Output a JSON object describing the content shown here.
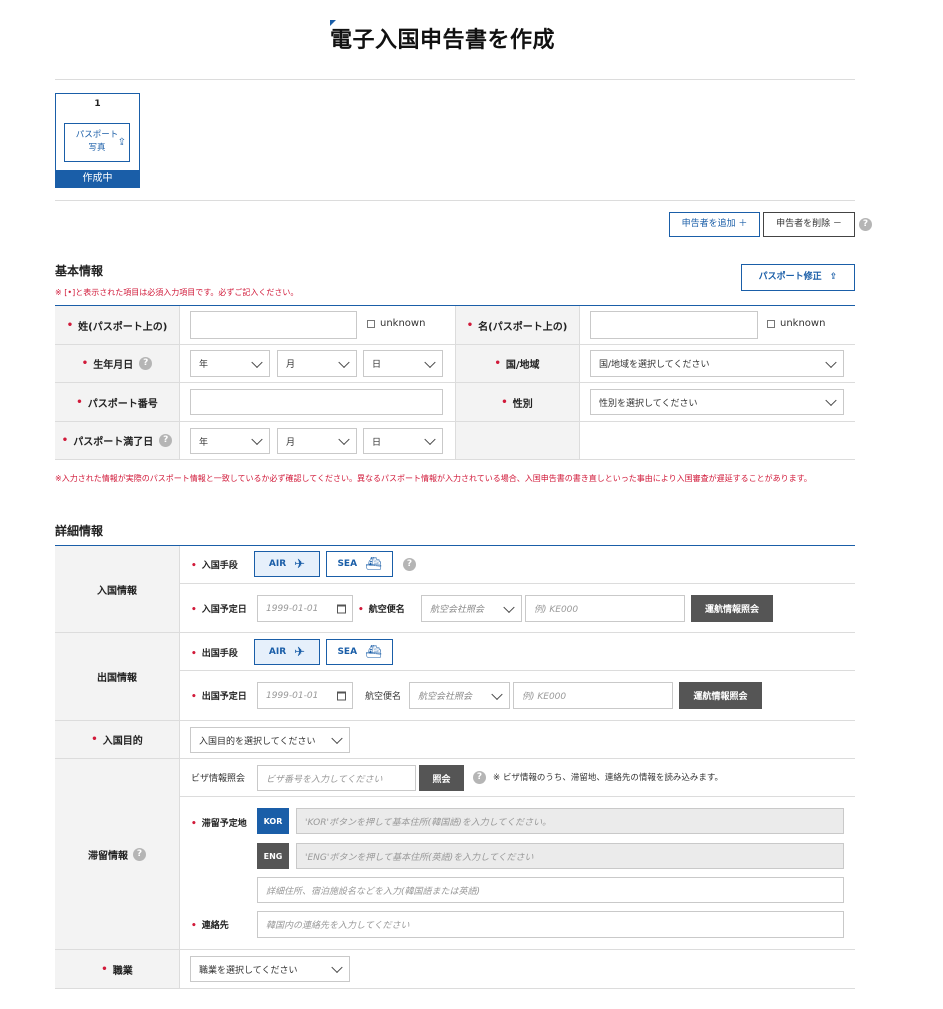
{
  "page": {
    "title": "電子入国申告書を作成"
  },
  "steps": [
    {
      "number": "1",
      "button": "パスポート 写真",
      "status": "作成中"
    }
  ],
  "toolbar": {
    "add": "申告者を追加 ＋",
    "remove": "申告者を削除 －",
    "help": "?"
  },
  "basic": {
    "title": "基本情報",
    "required_note": "※ [•]と表示された項目は必須入力項目です。必ずご記入ください。",
    "passport_edit": "パスポート修正",
    "surname_label": "姓(パスポート上の)",
    "given_label": "名(パスポート上の)",
    "unknown": "unknown",
    "birth_label": "生年月日",
    "year": "年",
    "month": "月",
    "day": "日",
    "country_label": "国/地域",
    "country_placeholder": "国/地域を選択してください",
    "passport_no_label": "パスポート番号",
    "gender_label": "性別",
    "gender_placeholder": "性別を選択してください",
    "expiry_label": "パスポート満了日",
    "warning": "※入力された情報が実際のパスポート情報と一致しているか必ず確認してください。異なるパスポート情報が入力されている場合、入国申告書の書き直しといった事由により入国審査が遅延することがあります。"
  },
  "detail": {
    "title": "詳細情報",
    "entry_info": "入国情報",
    "entry_means": "入国手段",
    "air": "AIR",
    "sea": "SEA",
    "entry_date": "入国予定日",
    "date_placeholder": "1999-01-01",
    "flight_label": "航空便名",
    "airline_placeholder": "航空会社照会",
    "flight_placeholder": "例) KE000",
    "flight_lookup": "運航情報照会",
    "exit_info": "出国情報",
    "exit_means": "出国手段",
    "exit_date": "出国予定日",
    "purpose_label": "入国目的",
    "purpose_placeholder": "入国目的を選択してください",
    "stay_info": "滞留情報",
    "visa_lookup_label": "ビザ情報照会",
    "visa_placeholder": "ビザ番号を入力してください",
    "visa_button": "照会",
    "visa_note": "※ ビザ情報のうち、滞留地、連絡先の情報を読み込みます。",
    "stay_address_label": "滞留予定地",
    "kor": "KOR",
    "eng": "ENG",
    "kor_placeholder": "'KOR'ボタンを押して基本住所(韓国語)を入力してください。",
    "eng_placeholder": "'ENG'ボタンを押して基本住所(英語)を入力してください",
    "detail_address_placeholder": "詳細住所、宿泊施設名などを入力(韓国語または英語)",
    "contact_label": "連絡先",
    "contact_placeholder": "韓国内の連絡先を入力してください",
    "job_label": "職業",
    "job_placeholder": "職業を選択してください"
  },
  "colors": {
    "accent": "#1a5ea8",
    "required": "#d11a3a",
    "dark_button": "#555555"
  }
}
